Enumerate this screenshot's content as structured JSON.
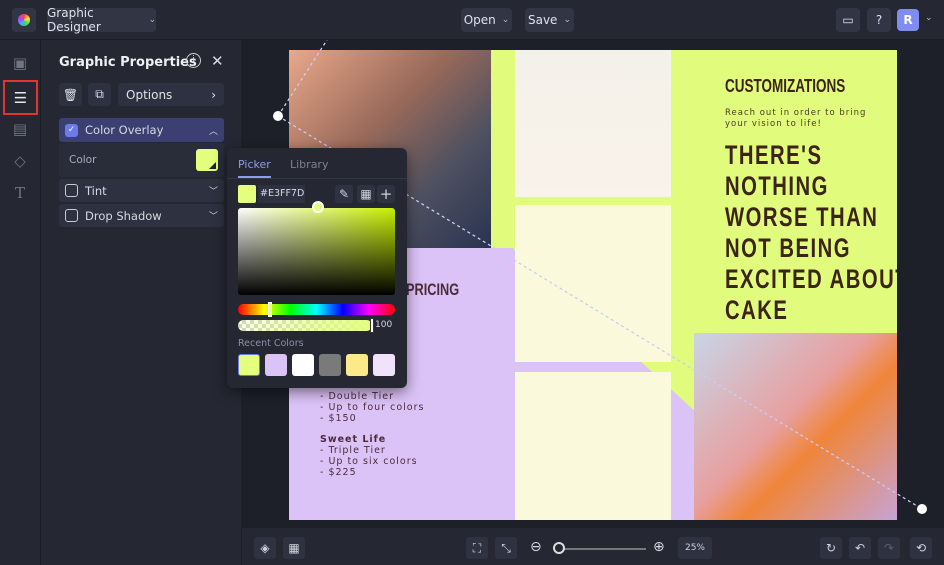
{
  "topbar": {
    "app_name": "Graphic Designer",
    "open_label": "Open",
    "save_label": "Save",
    "avatar_initial": "R"
  },
  "panel": {
    "title": "Graphic Properties",
    "options_label": "Options",
    "color_overlay_label": "Color Overlay",
    "color_label": "Color",
    "tint_label": "Tint",
    "drop_shadow_label": "Drop Shadow"
  },
  "picker": {
    "tab_picker": "Picker",
    "tab_library": "Library",
    "hex": "#E3FF7D",
    "opacity": "100",
    "recent_label": "Recent Colors",
    "recent_colors": [
      "#e3ff7d",
      "#dcc3f7",
      "#ffffff",
      "#7a7a7a",
      "#fbe98a",
      "#f1e2fb"
    ]
  },
  "design": {
    "customizations": "CUSTOMIZATIONS",
    "reach_out_1": "Reach out in order to bring",
    "reach_out_2": "your vision to life!",
    "headline": [
      "THERE'S",
      "NOTHING",
      "WORSE THAN",
      "NOT BEING",
      "EXCITED ABOUT",
      "CAKE"
    ],
    "pricing": "PRICING",
    "tier2": [
      "- Double Tier",
      "- Up to four colors",
      "- $150"
    ],
    "sweet_life": "Sweet Life",
    "tier3": [
      "- Triple Tier",
      "- Up to six colors",
      "- $225"
    ]
  },
  "bottombar": {
    "zoom": "25%"
  },
  "colors": {
    "accent": "#6c7bea",
    "highlight": "#e0362b",
    "overlay": "#e3ff7d"
  }
}
